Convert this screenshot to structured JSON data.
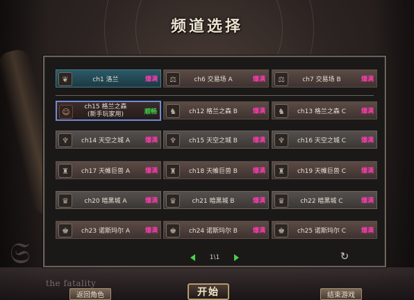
{
  "window": {
    "title": "频道选择"
  },
  "background": {
    "logo_text": "the fatality"
  },
  "featured_channels": [
    {
      "name": "ch1 洛兰",
      "status": "爆满",
      "style": "teal",
      "icon": "plant-icon"
    },
    {
      "name": "ch6 交易场 A",
      "status": "爆满",
      "style": "normal",
      "icon": "merchant-icon"
    },
    {
      "name": "ch7 交易场 B",
      "status": "爆满",
      "style": "normal",
      "icon": "merchant-icon"
    }
  ],
  "channels": [
    {
      "name": "ch15 格兰之森",
      "subtitle": "(新手玩家用)",
      "status": "顺畅",
      "status_type": "smooth",
      "style": "selected",
      "icon": "fox-icon"
    },
    {
      "name": "ch12 格兰之森 B",
      "status": "爆满",
      "style": "normal",
      "icon": "beast-icon"
    },
    {
      "name": "ch13 格兰之森 C",
      "status": "爆满",
      "style": "normal",
      "icon": "beast-icon"
    },
    {
      "name": "ch14 天空之城 A",
      "status": "爆满",
      "style": "gray",
      "icon": "bird-icon"
    },
    {
      "name": "ch15 天空之城 B",
      "status": "爆满",
      "style": "gray",
      "icon": "bird-icon"
    },
    {
      "name": "ch16 天空之城 C",
      "status": "爆满",
      "style": "gray",
      "icon": "bird-icon"
    },
    {
      "name": "ch17 天帷巨兽 A",
      "status": "爆满",
      "style": "normal",
      "icon": "giant-icon"
    },
    {
      "name": "ch18 天帷巨兽 B",
      "status": "爆满",
      "style": "normal",
      "icon": "giant-icon"
    },
    {
      "name": "ch19 天帷巨兽 C",
      "status": "爆满",
      "style": "normal",
      "icon": "giant-icon"
    },
    {
      "name": "ch20 暗黑城 A",
      "status": "爆满",
      "style": "gray",
      "icon": "demon-icon"
    },
    {
      "name": "ch21 暗黑城 B",
      "status": "爆满",
      "style": "gray",
      "icon": "demon-icon"
    },
    {
      "name": "ch22 暗黑城 C",
      "status": "爆满",
      "style": "gray",
      "icon": "demon-icon"
    },
    {
      "name": "ch23 诺斯玛尔 A",
      "status": "爆满",
      "style": "normal",
      "icon": "knight-icon"
    },
    {
      "name": "ch24 诺斯玛尔 B",
      "status": "爆满",
      "style": "normal",
      "icon": "knight-icon"
    },
    {
      "name": "ch25 诺斯玛尔 C",
      "status": "爆满",
      "style": "normal",
      "icon": "knight-icon"
    }
  ],
  "pagination": {
    "page_text": "1\\1"
  },
  "buttons": {
    "back_label": "返回角色",
    "start_label": "开始",
    "exit_label": "结束游戏"
  },
  "colors": {
    "status_full": "#ff3bb0",
    "status_smooth": "#3ed14a",
    "selected_border": "#6e8cd8"
  }
}
